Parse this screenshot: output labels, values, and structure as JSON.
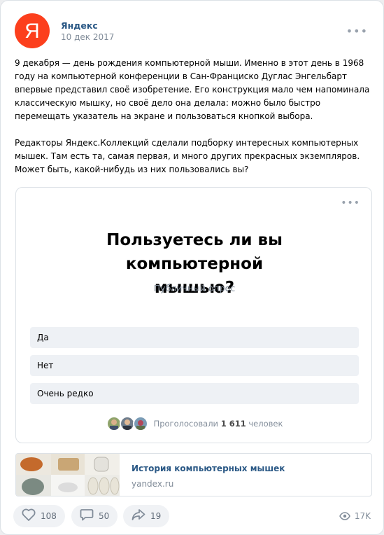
{
  "author": {
    "name": "Яндекс",
    "date": "10 дек 2017",
    "logo_letter": "Я"
  },
  "icons": {
    "more": "more-horizontal-icon",
    "like": "heart-icon",
    "comment": "comment-icon",
    "share": "share-icon",
    "views": "eye-icon"
  },
  "post": {
    "text": "9 декабря — день рождения компьютерной мыши. Именно в этот день в 1968 году на компьютерной конференции в Сан-Франциско Дуглас Энгельбарт впервые представил своё изобретение. Его конструкция мало чем напоминала классическую мышку, но своё дело она делала: можно было быстро перемещать указатель на экране и пользоваться кнопкой выбора.\n\nРедакторы Яндекс.Коллекций сделали подборку интересных компьютерных мышек. Там есть та, самая первая, и много других прекрасных экземпляров. Может быть, какой-нибудь из них пользовались вы?"
  },
  "poll": {
    "question": "Пользуетесь ли вы компьютерной мышью?",
    "type": "Публичный опрос",
    "options": [
      "Да",
      "Нет",
      "Очень редко"
    ],
    "voters_prefix": "Проголосовали",
    "voters_count": "1 611",
    "voters_suffix": "человек"
  },
  "link": {
    "title": "История компьютерных мышек",
    "domain": "yandex.ru"
  },
  "footer": {
    "likes": "108",
    "comments": "50",
    "shares": "19",
    "views": "17K"
  },
  "colors": {
    "brand": "#fc3f1d",
    "link": "#2a5885",
    "muted": "#818c99",
    "option_bg": "#eef1f5"
  }
}
